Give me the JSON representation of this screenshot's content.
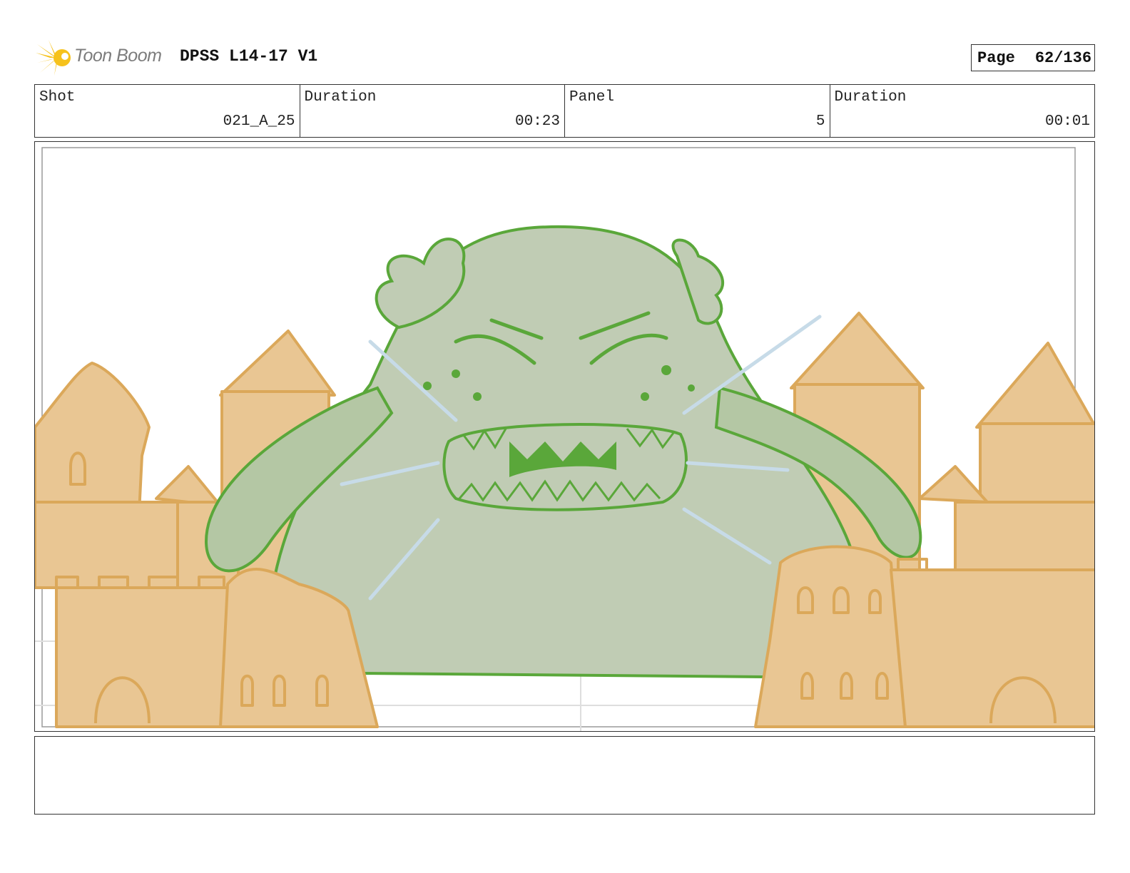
{
  "header": {
    "logo_text": "Toon Boom",
    "title": "DPSS L14-17 V1",
    "page_label": "Page",
    "page_value": "62/136"
  },
  "info": {
    "shot_label": "Shot",
    "shot_value": "021_A_25",
    "duration_label": "Duration",
    "duration_value": "00:23",
    "panel_label": "Panel",
    "panel_value": "5",
    "panel_duration_label": "Duration",
    "panel_duration_value": "00:01"
  },
  "colors": {
    "sand": "#e9c693",
    "sand_line": "#dba85a",
    "monster_fill": "#c0ccb4",
    "monster_line": "#5aa73a",
    "arm_shade": "#9dc08a",
    "motion_lines": "#c7dbe8",
    "logo_yellow": "#f6c21c"
  },
  "notes": {
    "text": ""
  }
}
